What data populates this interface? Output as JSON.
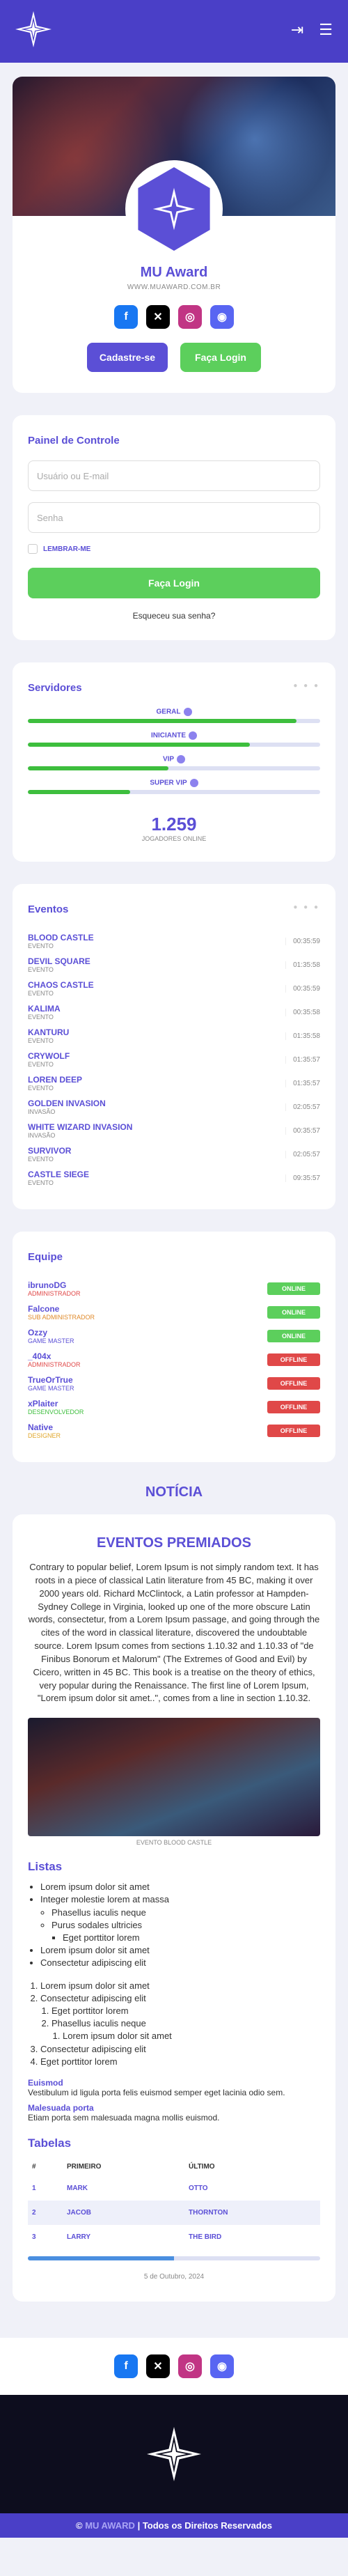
{
  "brand": {
    "title": "MU Award",
    "url": "WWW.MUAWARD.COM.BR"
  },
  "hero_buttons": {
    "register": "Cadastre-se",
    "login": "Faça Login"
  },
  "panel": {
    "title": "Painel de Controle",
    "user_placeholder": "Usuário ou E-mail",
    "pass_placeholder": "Senha",
    "remember": "LEMBRAR-ME",
    "submit": "Faça Login",
    "forgot": "Esqueceu sua senha?"
  },
  "servers": {
    "title": "Servidores",
    "items": [
      {
        "name": "GERAL",
        "fill": 0.92
      },
      {
        "name": "INICIANTE",
        "fill": 0.76
      },
      {
        "name": "VIP",
        "fill": 0.48
      },
      {
        "name": "SUPER VIP",
        "fill": 0.35
      }
    ],
    "online": "1.259",
    "online_label": "JOGADORES ONLINE"
  },
  "events": {
    "title": "Eventos",
    "items": [
      {
        "name": "BLOOD CASTLE",
        "type": "EVENTO",
        "time": "00:35:59"
      },
      {
        "name": "DEVIL SQUARE",
        "type": "EVENTO",
        "time": "01:35:58"
      },
      {
        "name": "CHAOS CASTLE",
        "type": "EVENTO",
        "time": "00:35:59"
      },
      {
        "name": "KALIMA",
        "type": "EVENTO",
        "time": "00:35:58"
      },
      {
        "name": "KANTURU",
        "type": "EVENTO",
        "time": "01:35:58"
      },
      {
        "name": "CRYWOLF",
        "type": "EVENTO",
        "time": "01:35:57"
      },
      {
        "name": "LOREN DEEP",
        "type": "EVENTO",
        "time": "01:35:57"
      },
      {
        "name": "GOLDEN INVASION",
        "type": "INVASÃO",
        "time": "02:05:57"
      },
      {
        "name": "WHITE WIZARD INVASION",
        "type": "INVASÃO",
        "time": "00:35:57"
      },
      {
        "name": "SURVIVOR",
        "type": "EVENTO",
        "time": "02:05:57"
      },
      {
        "name": "CASTLE SIEGE",
        "type": "EVENTO",
        "time": "09:35:57"
      }
    ]
  },
  "staff": {
    "title": "Equipe",
    "items": [
      {
        "name": "ibrunoDG",
        "role": "ADMINISTRADOR",
        "status": "ONLINE",
        "role_color": "#e04848"
      },
      {
        "name": "Falcone",
        "role": "SUB ADMINISTRADOR",
        "status": "ONLINE",
        "role_color": "#e08a2a"
      },
      {
        "name": "Ozzy",
        "role": "GAME MASTER",
        "status": "ONLINE",
        "role_color": "#5b4fd6"
      },
      {
        "name": "_404x",
        "role": "ADMINISTRADOR",
        "status": "OFFLINE",
        "role_color": "#e04848"
      },
      {
        "name": "TrueOrTrue",
        "role": "GAME MASTER",
        "status": "OFFLINE",
        "role_color": "#5b4fd6"
      },
      {
        "name": "xPlaiter",
        "role": "DESENVOLVEDOR",
        "status": "OFFLINE",
        "role_color": "#3dbe3d"
      },
      {
        "name": "Native",
        "role": "DESIGNER",
        "status": "OFFLINE",
        "role_color": "#e0a62a"
      }
    ]
  },
  "news": {
    "heading": "NOTÍCIA",
    "title": "EVENTOS PREMIADOS",
    "body": "Contrary to popular belief, Lorem Ipsum is not simply random text. It has roots in a piece of classical Latin literature from 45 BC, making it over 2000 years old. Richard McClintock, a Latin professor at Hampden-Sydney College in Virginia, looked up one of the more obscure Latin words, consectetur, from a Lorem Ipsum passage, and going through the cites of the word in classical literature, discovered the undoubtable source. Lorem Ipsum comes from sections 1.10.32 and 1.10.33 of \"de Finibus Bonorum et Malorum\" (The Extremes of Good and Evil) by Cicero, written in 45 BC. This book is a treatise on the theory of ethics, very popular during the Renaissance. The first line of Lorem Ipsum, \"Lorem ipsum dolor sit amet..\", comes from a line in section 1.10.32.",
    "caption": "EVENTO BLOOD CASTLE",
    "lists_title": "Listas",
    "ul": [
      "Lorem ipsum dolor sit amet",
      "Integer molestie lorem at massa",
      "Phasellus iaculis neque",
      "Purus sodales ultricies",
      "Eget porttitor lorem",
      "Lorem ipsum dolor sit amet",
      "Consectetur adipiscing elit"
    ],
    "ol": [
      "Lorem ipsum dolor sit amet",
      "Consectetur adipiscing elit",
      "Eget porttitor lorem",
      "Phasellus iaculis neque",
      "Lorem ipsum dolor sit amet",
      "Consectetur adipiscing elit",
      "Eget porttitor lorem"
    ],
    "dl": [
      {
        "term": "Euismod",
        "def": "Vestibulum id ligula porta felis euismod semper eget lacinia odio sem."
      },
      {
        "term": "Malesuada porta",
        "def": "Etiam porta sem malesuada magna mollis euismod."
      }
    ],
    "tables_title": "Tabelas",
    "table_headers": [
      "#",
      "PRIMEIRO",
      "ÚLTIMO"
    ],
    "table_rows": [
      [
        "1",
        "MARK",
        "OTTO"
      ],
      [
        "2",
        "JACOB",
        "THORNTON"
      ],
      [
        "3",
        "LARRY",
        "THE BIRD"
      ]
    ],
    "progress": 0.5,
    "date": "5 de Outubro, 2024"
  },
  "footer": {
    "brand": "MU AWARD",
    "rights": "Todos os Direitos Reservados"
  }
}
